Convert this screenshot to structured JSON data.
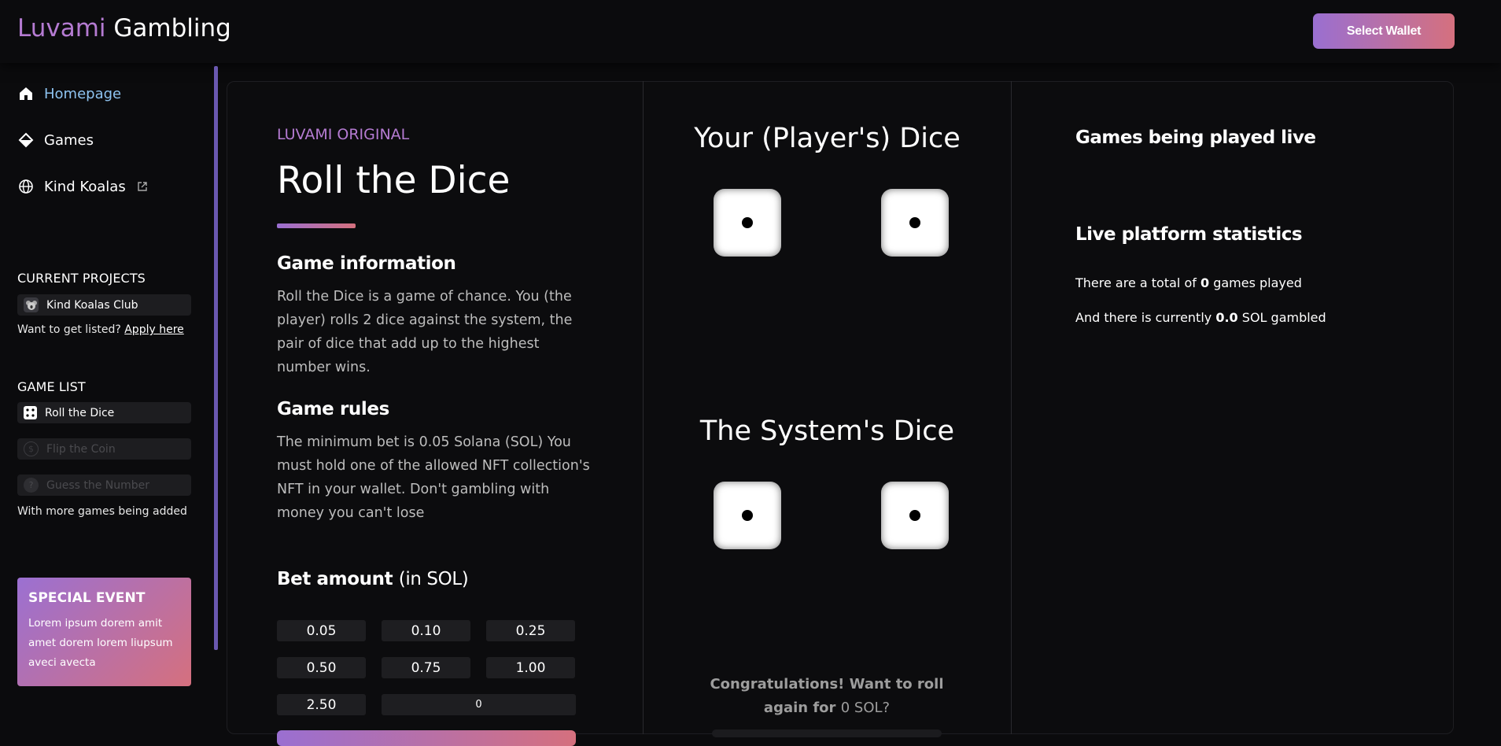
{
  "header": {
    "logo_part1": "Luvami",
    "logo_part2": "Gambling",
    "wallet_button": "Select Wallet"
  },
  "sidebar": {
    "nav": [
      {
        "label": "Homepage",
        "icon": "home-icon",
        "active": true
      },
      {
        "label": "Games",
        "icon": "diamond-icon",
        "active": false
      },
      {
        "label": "Kind Koalas",
        "icon": "globe-icon",
        "active": false,
        "external": true
      }
    ],
    "current_projects_title": "CURRENT PROJECTS",
    "projects": [
      {
        "label": "Kind Koalas Club",
        "icon": "koala-icon"
      }
    ],
    "listing_prompt": "Want to get listed?",
    "listing_link": "Apply here",
    "game_list_title": "GAME LIST",
    "games": [
      {
        "label": "Roll the Dice",
        "icon": "dice-icon",
        "enabled": true
      },
      {
        "label": "Flip the Coin",
        "icon": "coin-icon",
        "enabled": false
      },
      {
        "label": "Guess the Number",
        "icon": "question-icon",
        "enabled": false
      }
    ],
    "more_games_note": "With more games being added",
    "special_event": {
      "title": "SPECIAL EVENT",
      "text": "Lorem ipsum dorem amit amet dorem lorem liupsum aveci avecta"
    }
  },
  "game": {
    "kicker": "LUVAMI ORIGINAL",
    "title": "Roll the Dice",
    "info_heading": "Game information",
    "info_text": "Roll the Dice is a game of chance. You (the player) rolls 2 dice against the system, the pair of dice that add up to the highest number wins.",
    "rules_heading": "Game rules",
    "rules_text": "The minimum bet is 0.05 Solana (SOL) You must hold one of the allowed NFT collection's NFT in your wallet. Don't gambling with money you can't lose",
    "bet_heading": "Bet amount",
    "bet_unit": "(in SOL)",
    "bet_options": [
      "0.05",
      "0.10",
      "0.25",
      "0.50",
      "0.75",
      "1.00",
      "2.50"
    ],
    "bet_input_value": "0"
  },
  "dice": {
    "player_title": "Your (Player's) Dice",
    "player_values": [
      1,
      1
    ],
    "system_title": "The System's Dice",
    "system_values": [
      1,
      1
    ],
    "congrats_text": "Congratulations! Want to roll again for",
    "congrats_amount": "0 SOL?"
  },
  "stats": {
    "live_games_heading": "Games being played live",
    "platform_heading": "Live platform statistics",
    "total_prefix": "There are a total of",
    "total_games": "0",
    "total_suffix": "games played",
    "gambled_prefix": "And there is currently",
    "gambled_amount": "0.0",
    "gambled_suffix": "SOL gambled"
  }
}
